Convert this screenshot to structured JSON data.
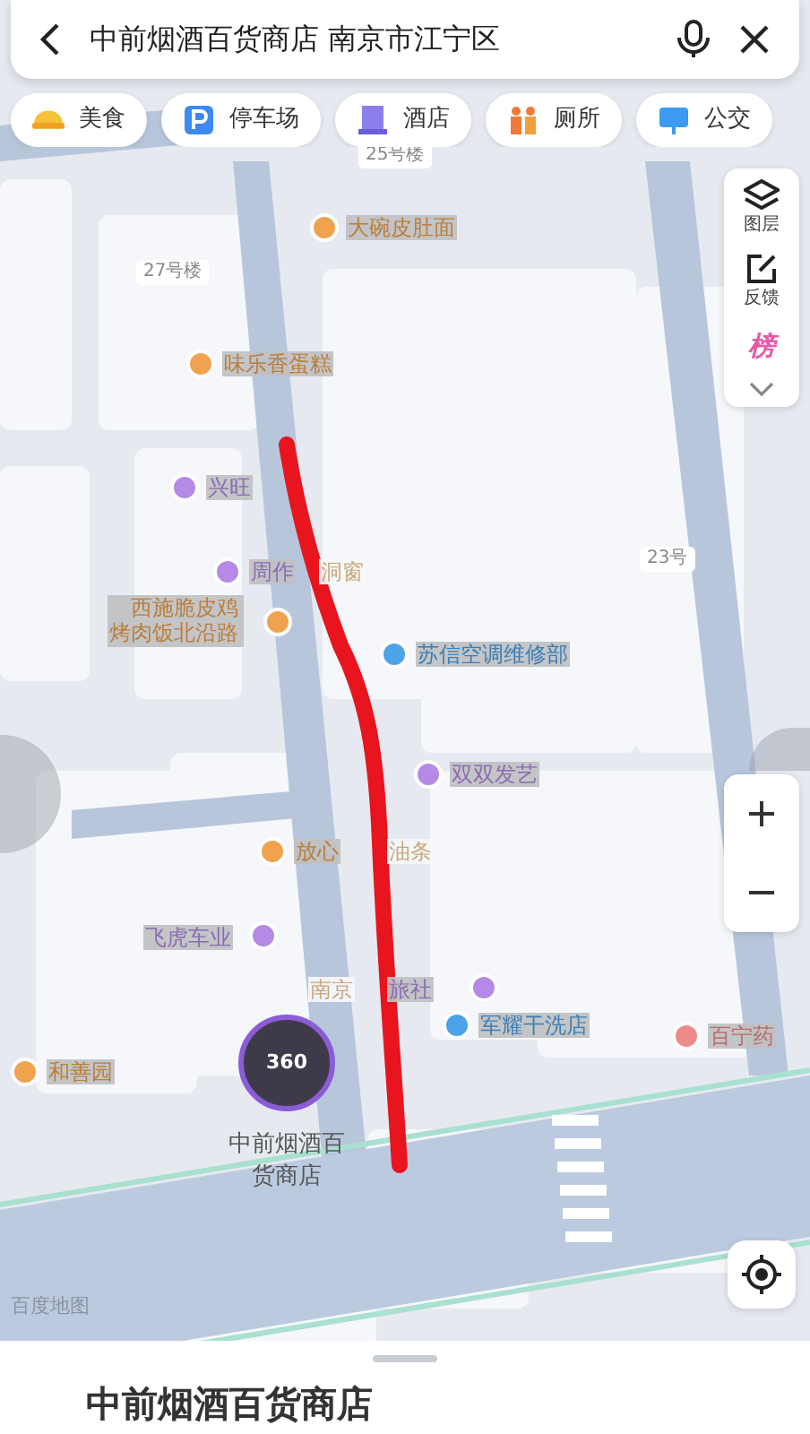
{
  "search": {
    "query": "中前烟酒百货商店 南京市江宁区"
  },
  "categories": [
    {
      "kind": "food",
      "label": "美食"
    },
    {
      "kind": "parking",
      "label": "停车场"
    },
    {
      "kind": "hotel",
      "label": "酒店"
    },
    {
      "kind": "toilet",
      "label": "厕所"
    },
    {
      "kind": "bus",
      "label": "公交"
    }
  ],
  "map": {
    "labels": [
      {
        "kind": "building",
        "text": "25号楼"
      },
      {
        "kind": "building",
        "text": "27号楼"
      },
      {
        "kind": "building",
        "text": "23号"
      },
      {
        "kind": "poi",
        "text": "大碗皮肚面",
        "color": "#f0a24e"
      },
      {
        "kind": "poi",
        "text": "味乐香蛋糕",
        "color": "#f0a24e"
      },
      {
        "kind": "poi",
        "text": "兴旺",
        "color": "#b48ae6"
      },
      {
        "kind": "poi",
        "text": "周作",
        "color": "#b48ae6"
      },
      {
        "kind": "text",
        "text": "洞窗"
      },
      {
        "kind": "poi",
        "text": "西施脆皮鸡烤肉饭北沿路",
        "color": "#f0a24e"
      },
      {
        "kind": "poi",
        "text": "苏信空调维修部",
        "color": "#4da3e8"
      },
      {
        "kind": "poi",
        "text": "双双发艺",
        "color": "#b48ae6"
      },
      {
        "kind": "poi",
        "text": "放心",
        "color": "#f0a24e"
      },
      {
        "kind": "text",
        "text": "油条"
      },
      {
        "kind": "poi",
        "text": "飞虎车业",
        "color": "#b48ae6"
      },
      {
        "kind": "text",
        "text": "南京"
      },
      {
        "kind": "poi",
        "text": "旅社",
        "color": "#b48ae6"
      },
      {
        "kind": "poi",
        "text": "军耀干洗店",
        "color": "#4da3e8"
      },
      {
        "kind": "poi",
        "text": "百宁药",
        "color": "#ef8a8a"
      },
      {
        "kind": "poi",
        "text": "和善园",
        "color": "#f0a24e"
      }
    ],
    "place": {
      "badge": "360",
      "name": "中前烟酒百货商店"
    },
    "logo": "百度地图"
  },
  "tools": [
    {
      "kind": "layers",
      "label": "图层"
    },
    {
      "kind": "feedback",
      "label": "反馈"
    },
    {
      "kind": "rank",
      "label": "榜"
    }
  ],
  "sheet": {
    "title": "中前烟酒百货商店"
  }
}
